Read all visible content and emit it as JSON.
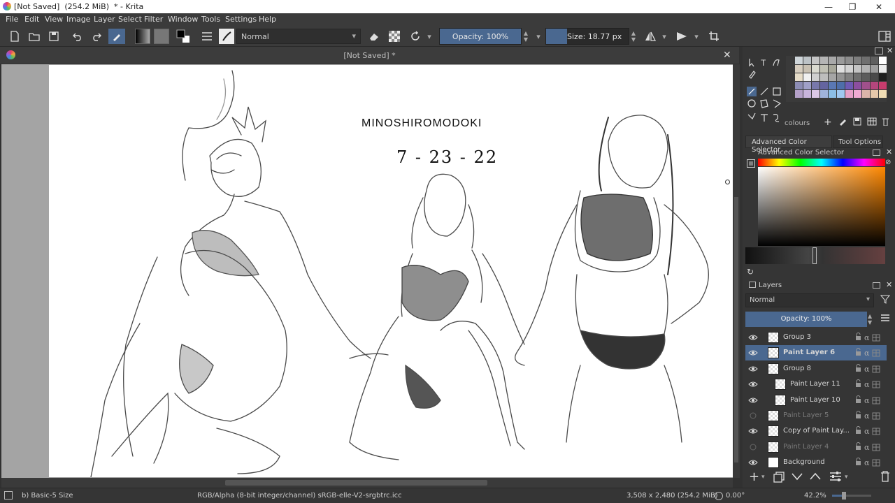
{
  "window": {
    "title": "[Not Saved]  (254.2 MiB)  * - Krita",
    "minimize": "—",
    "maximize": "❐",
    "close": "✕"
  },
  "menu": [
    "File",
    "Edit",
    "View",
    "Image",
    "Layer",
    "Select",
    "Filter",
    "Window",
    "Tools",
    "Settings",
    "Help"
  ],
  "toolbar": {
    "blend_mode": "Normal",
    "opacity": "Opacity: 100%",
    "opacity_value": 100,
    "size": "Size: 18.77 px"
  },
  "document_tab": {
    "title": "[Not Saved]  *",
    "close": "✕"
  },
  "canvas": {
    "artwork_title": "MINOSHIROMODOKI",
    "artwork_date": "7 - 23 - 22"
  },
  "docker": {
    "palette_label": "colours",
    "tabs": [
      "Advanced Color Selector",
      "Tool Options"
    ],
    "color_selector_title": "Advanced Color Selector",
    "layers_title": "Layers",
    "layer_blend_mode": "Normal",
    "layer_opacity": "Opacity:  100%",
    "layers": [
      {
        "name": "Group 3",
        "visible": true,
        "selected": false,
        "dim": false,
        "indent": 0
      },
      {
        "name": "Paint Layer 6",
        "visible": true,
        "selected": true,
        "dim": false,
        "indent": 0
      },
      {
        "name": "Group 8",
        "visible": true,
        "selected": false,
        "dim": false,
        "indent": 0
      },
      {
        "name": "Paint Layer 11",
        "visible": true,
        "selected": false,
        "dim": false,
        "indent": 1
      },
      {
        "name": "Paint Layer 10",
        "visible": true,
        "selected": false,
        "dim": false,
        "indent": 1
      },
      {
        "name": "Paint Layer 5",
        "visible": false,
        "selected": false,
        "dim": true,
        "indent": 0
      },
      {
        "name": "Copy of Paint Lay...",
        "visible": true,
        "selected": false,
        "dim": false,
        "indent": 0
      },
      {
        "name": "Paint Layer 4",
        "visible": false,
        "selected": false,
        "dim": true,
        "indent": 0
      },
      {
        "name": "Background",
        "visible": true,
        "selected": false,
        "dim": false,
        "indent": 0
      }
    ]
  },
  "status": {
    "brush": "b) Basic-5 Size",
    "color_space": "RGB/Alpha (8-bit integer/channel)  sRGB-elle-V2-srgbtrc.icc",
    "image_size": "3,508 x 2,480 (254.2 MiB)",
    "rotation": "0.00°",
    "zoom": "42.2%"
  },
  "colors": {
    "accent": "#4a6890",
    "panel_bg": "#353535",
    "toolbar_bg": "#3b3b3b"
  }
}
